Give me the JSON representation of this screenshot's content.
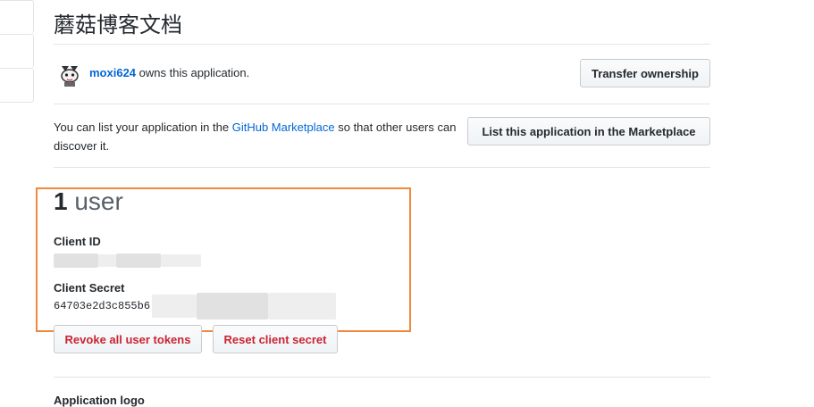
{
  "app": {
    "title": "蘑菇博客文档"
  },
  "owner": {
    "username": "moxi624",
    "suffix": "owns this application.",
    "transfer_label": "Transfer ownership",
    "avatar_icon": "avatar-illustration"
  },
  "marketplace": {
    "text_before": "You can list your application in the ",
    "link": "GitHub Marketplace",
    "text_after": " so that other users can discover it.",
    "button_label": "List this application in the Marketplace"
  },
  "credentials": {
    "users_count": "1",
    "users_word": "user",
    "client_id_label": "Client ID",
    "client_id_value": "",
    "client_secret_label": "Client Secret",
    "client_secret_value": "64703e2d3c855b6"
  },
  "actions": {
    "revoke_label": "Revoke all user tokens",
    "reset_label": "Reset client secret"
  },
  "next_section": {
    "heading": "Application logo"
  },
  "colors": {
    "link": "#0366d6",
    "danger": "#cb2431",
    "highlight_border": "#f0883e"
  }
}
